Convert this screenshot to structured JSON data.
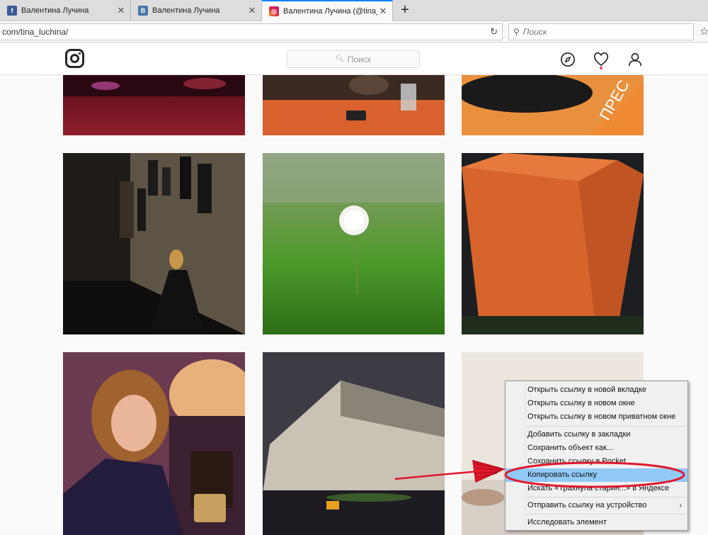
{
  "tabs": [
    {
      "title": "Валентина Лучина",
      "icon": "facebook-icon",
      "close": "✕"
    },
    {
      "title": "Валентина Лучина",
      "icon": "vk-icon",
      "close": "✕"
    },
    {
      "title": "Валентина Лучина (@tina_l",
      "icon": "instagram-icon",
      "close": "✕"
    }
  ],
  "new_tab": "+",
  "address": {
    "url": "com/tina_luchina/"
  },
  "browser_search": {
    "placeholder": "Поиск"
  },
  "instagram": {
    "search_placeholder": "Поиск",
    "icons": [
      "compass-icon",
      "heart-icon",
      "profile-icon"
    ]
  },
  "photos": [
    {
      "name": "photo-stage",
      "desc": "concert stage"
    },
    {
      "name": "photo-table",
      "desc": "press table"
    },
    {
      "name": "photo-press",
      "desc": "camera lens and poster"
    },
    {
      "name": "photo-gallery",
      "desc": "woman in gallery"
    },
    {
      "name": "photo-dandelion",
      "desc": "dandelion in grass"
    },
    {
      "name": "photo-bin",
      "desc": "orange container"
    },
    {
      "name": "photo-portrait",
      "desc": "woman portrait with telephone"
    },
    {
      "name": "photo-building",
      "desc": "old building at night"
    },
    {
      "name": "photo-interior",
      "desc": "interior"
    }
  ],
  "context_menu": {
    "items": [
      {
        "label": "Открыть ссылку в новой вкладке"
      },
      {
        "label": "Открыть ссылку в новом окне"
      },
      {
        "label": "Открыть ссылку в новом приватном окне"
      },
      {
        "label": "Добавить ссылку в закладки"
      },
      {
        "label": "Сохранить объект как..."
      },
      {
        "label": "Сохранить ссылку в Pocket"
      },
      {
        "label": "Копировать ссылку",
        "highlighted": true
      },
      {
        "label": "Искать «Трахнула старин...» в Яндексе"
      },
      {
        "label": "Отправить ссылку на устройство",
        "submenu_arrow": "›"
      },
      {
        "label": "Исследовать элемент"
      }
    ]
  },
  "colors": {
    "highlight": "#91c9f7",
    "annotation": "#e0182c",
    "tab_accent": "#0a84ff"
  }
}
